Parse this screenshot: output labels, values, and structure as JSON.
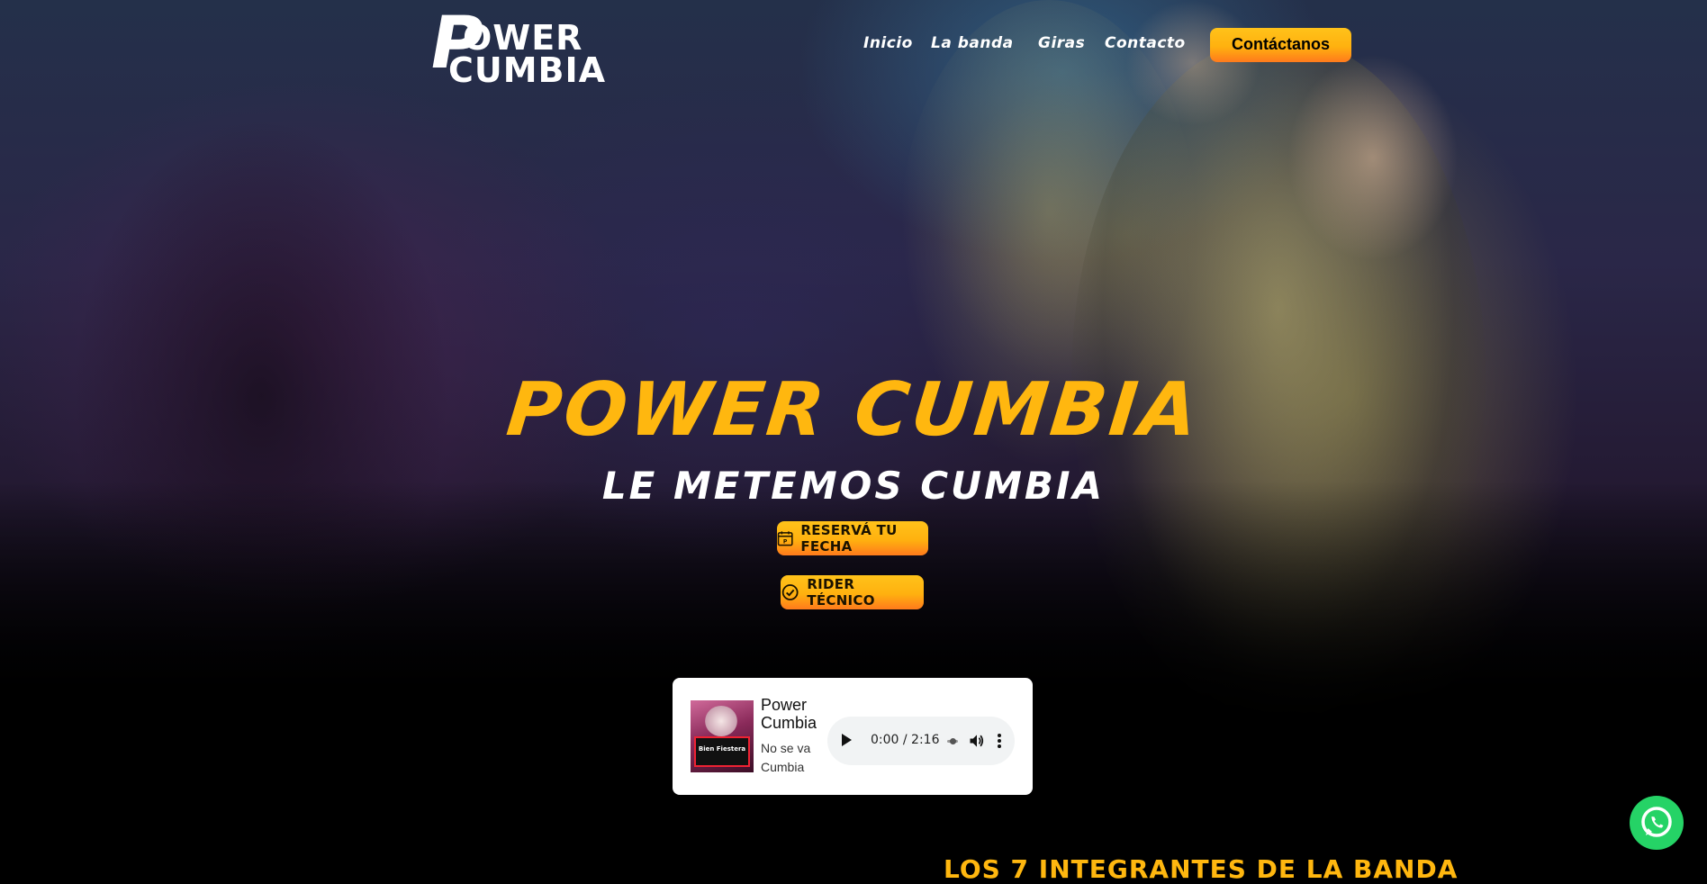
{
  "brand": {
    "logo_line1": "OWER",
    "logo_line2": "CUMBIA",
    "logo_initial": "P"
  },
  "nav": {
    "items": [
      {
        "label": "Inicio"
      },
      {
        "label": "La banda"
      },
      {
        "label": "Giras"
      },
      {
        "label": "Contacto"
      }
    ],
    "cta_label": "Contáctanos"
  },
  "hero": {
    "title": "POWER CUMBIA",
    "subtitle": "LE METEMOS CUMBIA",
    "buttons": [
      {
        "label": "RESERVÁ TU FECHA",
        "icon": "calendar-icon"
      },
      {
        "label": "RIDER TÉCNICO",
        "icon": "check-circle-icon"
      }
    ]
  },
  "audio_card": {
    "artist": "Power Cumbia",
    "track": "No se va Cumbia",
    "time": "0:00 / 2:16",
    "progress": 0.0,
    "cover_text": "Bien Fiestera"
  },
  "section": {
    "members_heading": "LOS 7 INTEGRANTES DE LA BANDA"
  },
  "colors": {
    "accent": "#ffb70f",
    "accent_gradient_end": "#ff7a1c",
    "whatsapp": "#25d366",
    "background": "#000000"
  },
  "icons": {
    "whatsapp": "whatsapp-icon",
    "play": "play-icon",
    "volume": "volume-icon",
    "more": "more-vertical-icon"
  }
}
